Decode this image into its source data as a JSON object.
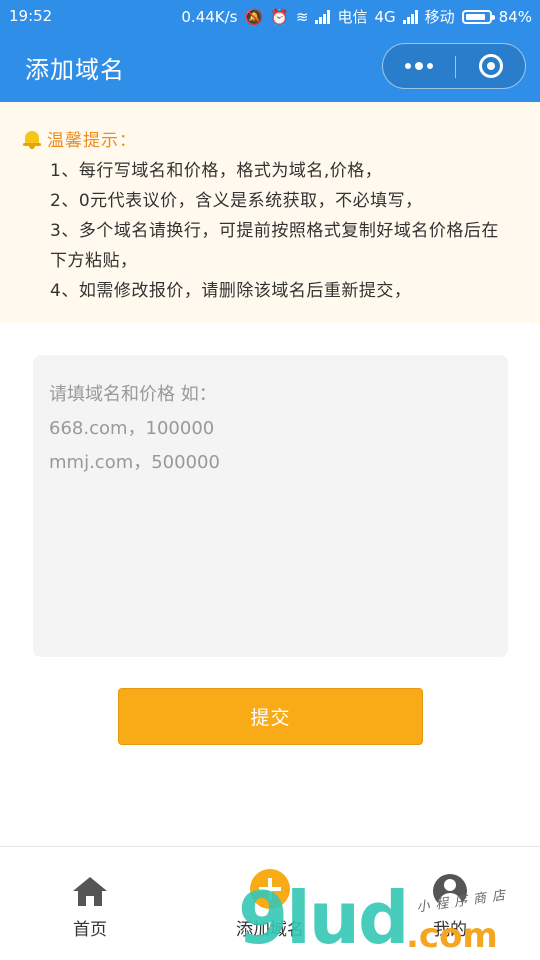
{
  "status_bar": {
    "time": "19:52",
    "speed": "0.44K/s",
    "carrier1": "电信",
    "network": "4G",
    "carrier2": "移动",
    "battery": "84%"
  },
  "nav": {
    "title": "添加域名"
  },
  "notice": {
    "title": "温馨提示：",
    "items": [
      "1、每行写域名和价格，格式为域名,价格，",
      "2、0元代表议价，含义是系统获取，不必填写，",
      "3、多个域名请换行，可提前按照格式复制好域名价格后在下方粘贴，",
      "4、如需修改报价，请删除该域名后重新提交，"
    ]
  },
  "form": {
    "placeholder": "请填域名和价格 如：\n668.com，100000\nmmj.com，500000",
    "submit_label": "提交"
  },
  "tabbar": {
    "items": [
      {
        "label": "首页",
        "icon": "home-icon"
      },
      {
        "label": "添加域名",
        "icon": "add-circle-icon"
      },
      {
        "label": "我的",
        "icon": "user-icon"
      }
    ]
  },
  "watermark": {
    "logo": "9lud",
    "domain": ".com",
    "script": "小程序商店"
  },
  "colors": {
    "header": "#2f8fe8",
    "notice_bg": "#fff9ee",
    "notice_title": "#f08c1a",
    "accent": "#f9ab17"
  }
}
